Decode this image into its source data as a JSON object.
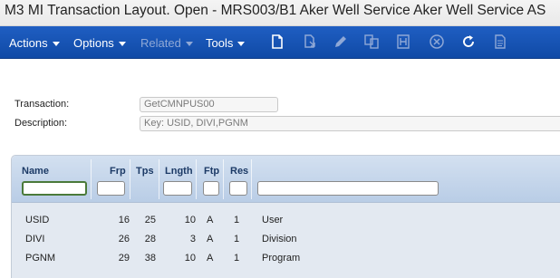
{
  "window": {
    "title": "M3 MI Transaction Layout. Open - MRS003/B1   Aker Well Service Aker Well Service AS"
  },
  "toolbar": {
    "menus": [
      {
        "label": "Actions"
      },
      {
        "label": "Options"
      },
      {
        "label": "Related"
      },
      {
        "label": "Tools"
      }
    ],
    "icons": [
      "new-document-icon",
      "copy-icon",
      "edit-icon",
      "duplicate-icon",
      "compare-icon",
      "delete-icon",
      "refresh-icon",
      "notes-icon"
    ]
  },
  "form": {
    "transaction_label": "Transaction:",
    "transaction_value": "GetCMNPUS00",
    "description_label": "Description:",
    "description_value": "Key: USID, DIVI,PGNM"
  },
  "grid": {
    "columns": [
      "Name",
      "Frp",
      "Tps",
      "Lngth",
      "Ftp",
      "Res"
    ],
    "rows": [
      {
        "name": "USID",
        "frp": "16",
        "tps": "25",
        "lngth": "10",
        "ftp": "A",
        "res": "1",
        "desc": "User"
      },
      {
        "name": "DIVI",
        "frp": "26",
        "tps": "28",
        "lngth": "3",
        "ftp": "A",
        "res": "1",
        "desc": "Division"
      },
      {
        "name": "PGNM",
        "frp": "29",
        "tps": "38",
        "lngth": "10",
        "ftp": "A",
        "res": "1",
        "desc": "Program"
      }
    ]
  },
  "colors": {
    "toolbar_bg": "#1552b5",
    "grid_header": "#c8d8ec",
    "grid_body": "#e3e9f1"
  }
}
